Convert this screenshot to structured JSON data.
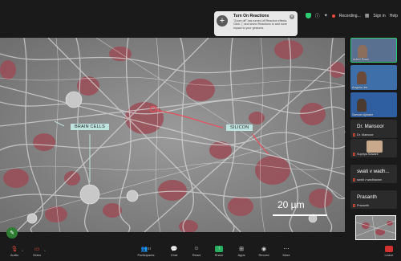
{
  "topbar": {
    "recording_label": "Recording...",
    "signin_label": "Sign in",
    "help_label": "Help"
  },
  "toast": {
    "title": "Turn On Reactions",
    "message": "\"Zoom off\" has turned off Reaction effects. Click ⓘ and select Reactions to add more impact to your gestures."
  },
  "stage": {
    "label_brain": "BRAIN CELLS",
    "label_silicon": "SILICON",
    "scale_text": "20 µm"
  },
  "participants_panel": {
    "video_tiles": [
      {
        "name": "Adeel Raza"
      },
      {
        "name": "Angela Lee"
      },
      {
        "name": "Samuel Ajibade"
      }
    ],
    "name_tiles": [
      {
        "display": "Dr. Mansoor",
        "sub": "Dr. Mansoor"
      },
      {
        "display": "",
        "sub": "Supriya Sawant"
      },
      {
        "display": "swati v wadh...",
        "sub": "swati v wadhawan"
      },
      {
        "display": "Prasanth",
        "sub": "Prasanth"
      }
    ]
  },
  "controls": {
    "audio": "Audio",
    "video": "Video",
    "participants": "Participants",
    "participants_count": "37",
    "chat": "Chat",
    "react": "React",
    "share": "Share",
    "apps": "Apps",
    "record": "Record",
    "more": "More",
    "leave": "Leave"
  },
  "colors": {
    "accent_green": "#27ae60",
    "leave_red": "#d32f2f",
    "label_bg": "#bfe3df",
    "annotation_red": "#e8505b"
  }
}
